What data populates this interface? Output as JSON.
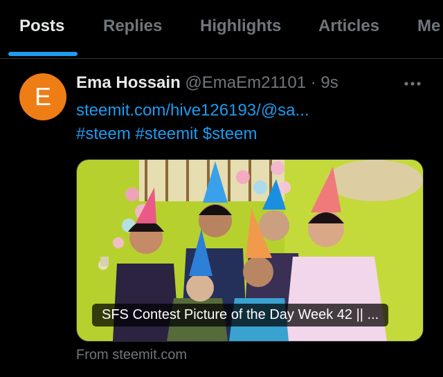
{
  "tabs": [
    {
      "label": "Posts",
      "active": true
    },
    {
      "label": "Replies",
      "active": false
    },
    {
      "label": "Highlights",
      "active": false
    },
    {
      "label": "Articles",
      "active": false
    },
    {
      "label": "Me",
      "active": false
    }
  ],
  "post": {
    "avatar_letter": "E",
    "avatar_color": "#ef7d16",
    "author_name": "Ema Hossain",
    "handle": "@EmaEm21101",
    "separator": "·",
    "time": "9s",
    "link_text": "steemit.com/hive126193/@sa...",
    "hashtags": "#steem #steemit $steem",
    "card": {
      "title": "SFS Contest Picture of the Day Week 42 || ...",
      "image_description_icon": "photo-children-party-hats"
    },
    "source": "From steemit.com"
  },
  "colors": {
    "accent": "#1d9bf0",
    "background": "#000000",
    "muted_text": "#71767b"
  }
}
